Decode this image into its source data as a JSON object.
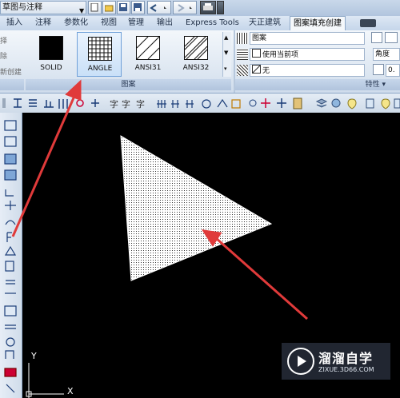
{
  "titlebar": {
    "title": "草图与注释"
  },
  "tabs": [
    {
      "label": "插入",
      "active": false
    },
    {
      "label": "注释",
      "active": false
    },
    {
      "label": "参数化",
      "active": false
    },
    {
      "label": "视图",
      "active": false
    },
    {
      "label": "管理",
      "active": false
    },
    {
      "label": "输出",
      "active": false
    },
    {
      "label": "Express Tools",
      "active": false
    },
    {
      "label": "天正建筑",
      "active": false
    },
    {
      "label": "图案填充创建",
      "active": true
    }
  ],
  "ribbon": {
    "left_partial": [
      "择",
      "除",
      "新创建"
    ],
    "patterns": [
      {
        "label": "SOLID",
        "swatch": "solid",
        "selected": false
      },
      {
        "label": "ANGLE",
        "swatch": "grid",
        "selected": true
      },
      {
        "label": "ANSI31",
        "swatch": "diag",
        "selected": false
      },
      {
        "label": "ANSI32",
        "swatch": "diag2",
        "selected": false
      }
    ],
    "pattern_panel_label": "图案",
    "properties": {
      "type": "图案",
      "color": "使用当前项",
      "background": "无",
      "angle_label": "角度",
      "value": "0.",
      "panel_label": "特性 ▾"
    }
  },
  "watermark": {
    "brand": "溜溜自学",
    "url": "ZIXUE.3D66.COM"
  },
  "axes": {
    "y": "Y",
    "x": "X"
  },
  "colors": {
    "accent_arrow": "#e03a3a",
    "canvas": "#000000",
    "ribbon": "#dce6f1"
  }
}
